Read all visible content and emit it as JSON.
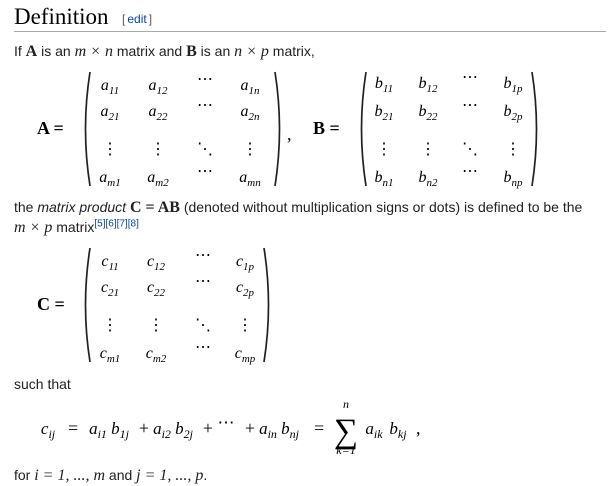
{
  "section": {
    "title": "Definition",
    "edit_open": "[",
    "edit_label": "edit",
    "edit_close": "]"
  },
  "intro": {
    "p1": "If ",
    "A": "A",
    "p2": " is an ",
    "mxn": "m × n",
    "p3": " matrix and ",
    "B": "B",
    "p4": " is an ",
    "nxp": "n × p",
    "p5": " matrix,"
  },
  "matrixA": {
    "name": "A",
    "rows": [
      [
        [
          "a",
          "11"
        ],
        [
          "a",
          "12"
        ],
        [
          "⋯",
          ""
        ],
        [
          "a",
          "1n"
        ]
      ],
      [
        [
          "a",
          "21"
        ],
        [
          "a",
          "22"
        ],
        [
          "⋯",
          ""
        ],
        [
          "a",
          "2n"
        ]
      ],
      [
        [
          "⋮",
          ""
        ],
        [
          "⋮",
          ""
        ],
        [
          "⋱",
          ""
        ],
        [
          "⋮",
          ""
        ]
      ],
      [
        [
          "a",
          "m1"
        ],
        [
          "a",
          "m2"
        ],
        [
          "⋯",
          ""
        ],
        [
          "a",
          "mn"
        ]
      ]
    ]
  },
  "matrixB": {
    "name": "B",
    "rows": [
      [
        [
          "b",
          "11"
        ],
        [
          "b",
          "12"
        ],
        [
          "⋯",
          ""
        ],
        [
          "b",
          "1p"
        ]
      ],
      [
        [
          "b",
          "21"
        ],
        [
          "b",
          "22"
        ],
        [
          "⋯",
          ""
        ],
        [
          "b",
          "2p"
        ]
      ],
      [
        [
          "⋮",
          ""
        ],
        [
          "⋮",
          ""
        ],
        [
          "⋱",
          ""
        ],
        [
          "⋮",
          ""
        ]
      ],
      [
        [
          "b",
          "n1"
        ],
        [
          "b",
          "n2"
        ],
        [
          "⋯",
          ""
        ],
        [
          "b",
          "np"
        ]
      ]
    ]
  },
  "product_text": {
    "p1": "the ",
    "term": "matrix product",
    "eq": "C = AB",
    "p2": " (denoted without multiplication signs or dots) is defined to be the",
    "mxp": "m × p",
    "p3": " matrix",
    "refs": [
      "[5]",
      "[6]",
      "[7]",
      "[8]"
    ]
  },
  "matrixC": {
    "name": "C",
    "rows": [
      [
        [
          "c",
          "11"
        ],
        [
          "c",
          "12"
        ],
        [
          "⋯",
          ""
        ],
        [
          "c",
          "1p"
        ]
      ],
      [
        [
          "c",
          "21"
        ],
        [
          "c",
          "22"
        ],
        [
          "⋯",
          ""
        ],
        [
          "c",
          "2p"
        ]
      ],
      [
        [
          "⋮",
          ""
        ],
        [
          "⋮",
          ""
        ],
        [
          "⋱",
          ""
        ],
        [
          "⋮",
          ""
        ]
      ],
      [
        [
          "c",
          "m1"
        ],
        [
          "c",
          "m2"
        ],
        [
          "⋯",
          ""
        ],
        [
          "c",
          "mp"
        ]
      ]
    ]
  },
  "such_that": "such that",
  "formula": {
    "lhs": [
      "c",
      "ij"
    ],
    "terms": [
      [
        [
          "a",
          "i1"
        ],
        [
          "b",
          "1j"
        ]
      ],
      [
        [
          "a",
          "i2"
        ],
        [
          "b",
          "2j"
        ]
      ],
      [
        [
          "⋯",
          ""
        ]
      ],
      [
        [
          "a",
          "in"
        ],
        [
          "b",
          "nj"
        ]
      ]
    ],
    "sum_upper": "n",
    "sum_lower": "k=1",
    "sum_term": [
      [
        "a",
        "ik"
      ],
      [
        "b",
        "kj"
      ]
    ],
    "trail": ","
  },
  "footer": {
    "p1": "for ",
    "i_range": "i = 1, ..., m",
    "p2": " and ",
    "j_range": "j = 1, ..., p",
    "p3": "."
  }
}
